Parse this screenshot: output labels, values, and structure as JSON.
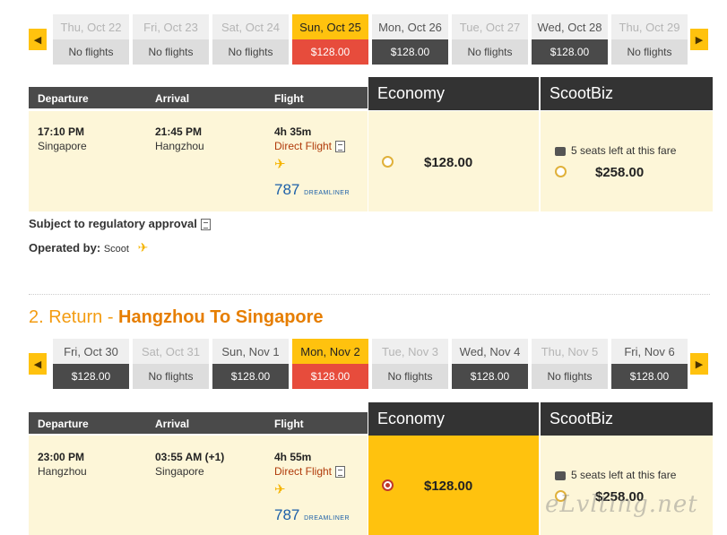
{
  "outbound": {
    "dates": [
      {
        "day": "Thu, Oct 22",
        "fare": "No flights",
        "state": "dim"
      },
      {
        "day": "Fri, Oct 23",
        "fare": "No flights",
        "state": "dim"
      },
      {
        "day": "Sat, Oct 24",
        "fare": "No flights",
        "state": "dim"
      },
      {
        "day": "Sun, Oct 25",
        "fare": "$128.00",
        "state": "sel"
      },
      {
        "day": "Mon, Oct 26",
        "fare": "$128.00",
        "state": "avail"
      },
      {
        "day": "Tue, Oct 27",
        "fare": "No flights",
        "state": "dim"
      },
      {
        "day": "Wed, Oct 28",
        "fare": "$128.00",
        "state": "avail"
      },
      {
        "day": "Thu, Oct 29",
        "fare": "No flights",
        "state": "dim"
      }
    ],
    "headers": {
      "departure": "Departure",
      "arrival": "Arrival",
      "flight": "Flight"
    },
    "cabins": {
      "economy": "Economy",
      "scootbiz": "ScootBiz"
    },
    "flight": {
      "dep_time": "17:10 PM",
      "dep_city": "Singapore",
      "arr_time": "21:45 PM",
      "arr_city": "Hangzhou",
      "duration": "4h 35m",
      "type": "Direct Flight",
      "aircraft": "787",
      "aircraft_sub": "DREAMLINER",
      "economy_price": "$128.00",
      "biz_seats": "5 seats left at this fare",
      "biz_price": "$258.00"
    }
  },
  "notes": {
    "regulatory": "Subject to regulatory approval",
    "operated_label": "Operated by:",
    "operated_value": "Scoot"
  },
  "return_section": {
    "prefix": "2. Return - ",
    "route": "Hangzhou To Singapore"
  },
  "return": {
    "dates": [
      {
        "day": "Fri, Oct 30",
        "fare": "$128.00",
        "state": "avail"
      },
      {
        "day": "Sat, Oct 31",
        "fare": "No flights",
        "state": "dim"
      },
      {
        "day": "Sun, Nov 1",
        "fare": "$128.00",
        "state": "avail"
      },
      {
        "day": "Mon, Nov 2",
        "fare": "$128.00",
        "state": "sel"
      },
      {
        "day": "Tue, Nov 3",
        "fare": "No flights",
        "state": "dim"
      },
      {
        "day": "Wed, Nov 4",
        "fare": "$128.00",
        "state": "avail"
      },
      {
        "day": "Thu, Nov 5",
        "fare": "No flights",
        "state": "dim"
      },
      {
        "day": "Fri, Nov 6",
        "fare": "$128.00",
        "state": "avail"
      }
    ],
    "headers": {
      "departure": "Departure",
      "arrival": "Arrival",
      "flight": "Flight"
    },
    "cabins": {
      "economy": "Economy",
      "scootbiz": "ScootBiz"
    },
    "flight": {
      "dep_time": "23:00 PM",
      "dep_city": "Hangzhou",
      "arr_time": "03:55 AM (+1)",
      "arr_city": "Singapore",
      "duration": "4h 55m",
      "type": "Direct Flight",
      "aircraft": "787",
      "aircraft_sub": "DREAMLINER",
      "economy_price": "$128.00",
      "biz_seats": "5 seats left at this fare",
      "biz_price": "$258.00"
    }
  },
  "watermark": "eLvlting.net",
  "colors": {
    "accent": "#ffc20e",
    "selected_fare": "#e74c3c",
    "header": "#4a4a4a",
    "row_bg": "#fdf6d8"
  }
}
